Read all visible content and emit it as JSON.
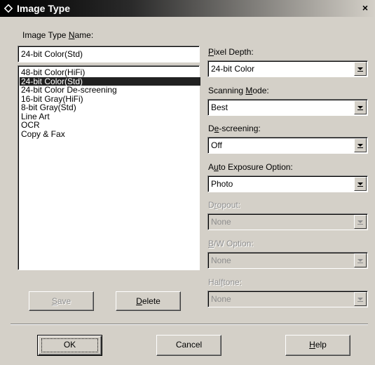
{
  "window": {
    "title": "Image Type",
    "close_glyph": "×"
  },
  "name_field": {
    "label": "Image Type Name:",
    "value": "24-bit Color(Std)"
  },
  "list": {
    "items": [
      "48-bit Color(HiFi)",
      "24-bit Color(Std)",
      "24-bit Color De-screening",
      "16-bit Gray(HiFi)",
      "8-bit Gray(Std)",
      "Line Art",
      "OCR",
      "Copy & Fax"
    ],
    "selected_index": 1
  },
  "options": {
    "pixel_depth": {
      "label": "Pixel Depth:",
      "value": "24-bit Color",
      "enabled": true
    },
    "scanning_mode": {
      "label": "Scanning Mode:",
      "value": "Best",
      "enabled": true
    },
    "descreening": {
      "label": "De-screening:",
      "value": "Off",
      "enabled": true
    },
    "auto_exposure": {
      "label": "Auto Exposure Option:",
      "value": "Photo",
      "enabled": true
    },
    "dropout": {
      "label": "Dropout:",
      "value": "None",
      "enabled": false
    },
    "bw_option": {
      "label": "B/W Option:",
      "value": "None",
      "enabled": false
    },
    "halftone": {
      "label": "Halftone:",
      "value": "None",
      "enabled": false
    }
  },
  "buttons": {
    "save": "Save",
    "delete": "Delete",
    "ok": "OK",
    "cancel": "Cancel",
    "help": "Help"
  },
  "icons": {
    "title": "scanner-app-icon",
    "combo_arrow": "dropdown-arrow-icon"
  },
  "colors": {
    "face": "#d4d0c8",
    "selection": "#212121",
    "title_bar": "#000000"
  }
}
